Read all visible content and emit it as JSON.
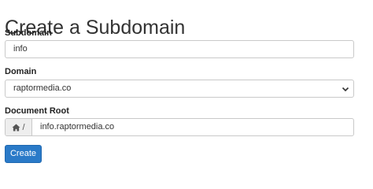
{
  "page": {
    "title": "Create a Subdomain"
  },
  "form": {
    "subdomain": {
      "label": "Subdomain",
      "value": "info"
    },
    "domain": {
      "label": "Domain",
      "selected": "raptormedia.co"
    },
    "document_root": {
      "label": "Document Root",
      "prefix": "/",
      "value": "info.raptormedia.co",
      "prefix_icon": "home-icon"
    },
    "submit_label": "Create"
  },
  "colors": {
    "primary_button": "#2a7ac8",
    "border": "#c9c9c9",
    "addon_background": "#eeeeee"
  }
}
